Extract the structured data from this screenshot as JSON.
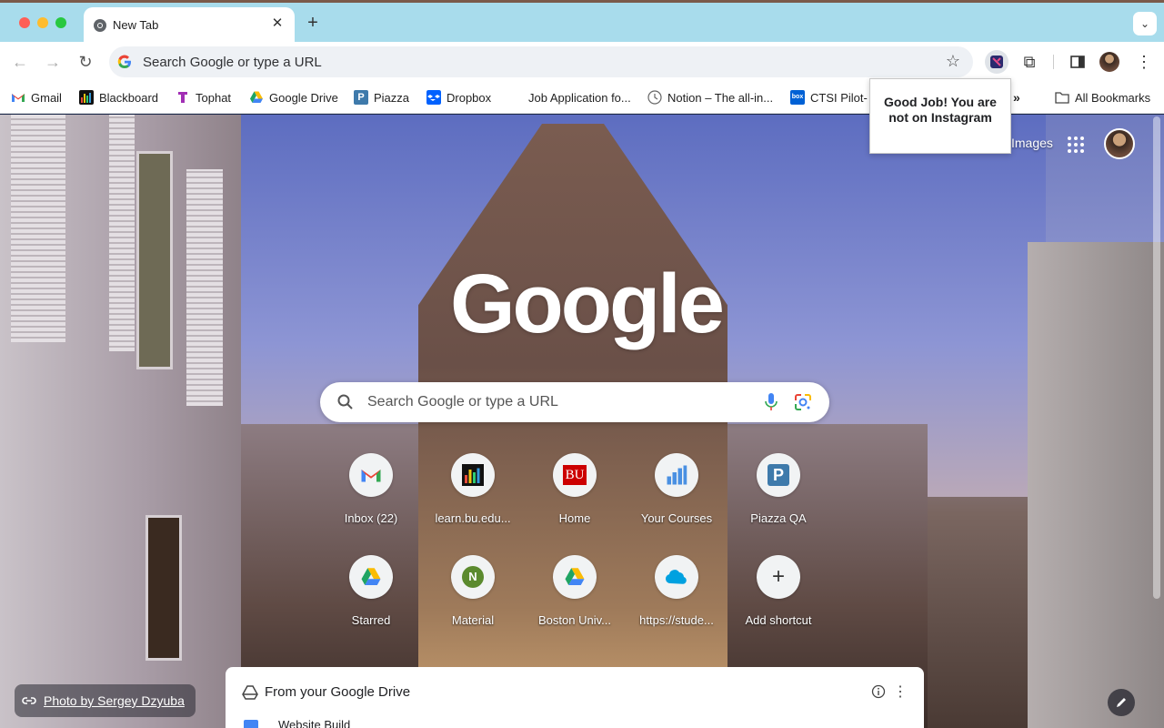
{
  "window": {
    "controls": [
      "close",
      "minimize",
      "maximize"
    ]
  },
  "tab": {
    "title": "New Tab",
    "close_icon": "close-icon"
  },
  "toolbar": {
    "omnibox_placeholder": "Search Google or type a URL"
  },
  "bookmarks": [
    {
      "label": "Gmail",
      "icon": "gmail-icon"
    },
    {
      "label": "Blackboard",
      "icon": "blackboard-icon"
    },
    {
      "label": "Tophat",
      "icon": "tophat-icon"
    },
    {
      "label": "Google Drive",
      "icon": "drive-icon"
    },
    {
      "label": "Piazza",
      "icon": "piazza-icon"
    },
    {
      "label": "Dropbox",
      "icon": "dropbox-icon"
    },
    {
      "label": "Job Application fo...",
      "icon": "blank-icon"
    },
    {
      "label": "Notion – The all-in...",
      "icon": "notion-icon"
    },
    {
      "label": "CTSI Pilot-",
      "icon": "box-icon"
    }
  ],
  "bookmarks_all": "All Bookmarks",
  "popup": {
    "text": "Good Job! You are not on Instagram"
  },
  "ntp": {
    "images_link": "Images",
    "logo": "Google",
    "search_placeholder": "Search Google or type a URL",
    "shortcuts": [
      {
        "label": "Inbox (22)",
        "icon": "gmail-icon"
      },
      {
        "label": "learn.bu.edu...",
        "icon": "blackboard-icon"
      },
      {
        "label": "Home",
        "icon": "bu-icon",
        "text": "BU"
      },
      {
        "label": "Your Courses",
        "icon": "bar-chart-icon"
      },
      {
        "label": "Piazza QA",
        "icon": "piazza-icon",
        "text": "P"
      },
      {
        "label": "Starred",
        "icon": "drive-icon"
      },
      {
        "label": "Material",
        "icon": "letter-n-icon",
        "text": "N"
      },
      {
        "label": "Boston Univ...",
        "icon": "drive-icon"
      },
      {
        "label": "https://stude...",
        "icon": "salesforce-icon"
      },
      {
        "label": "Add shortcut",
        "icon": "plus-icon"
      }
    ],
    "drive": {
      "title": "From your Google Drive",
      "files": [
        "Website Build"
      ]
    },
    "credit": "Photo by Sergey Dzyuba"
  }
}
